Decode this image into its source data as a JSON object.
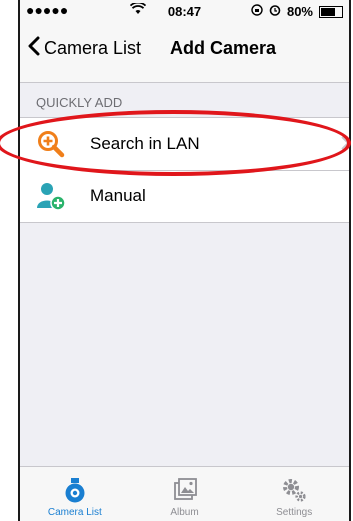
{
  "status_bar": {
    "signal": "●●●●●",
    "time": "08:47",
    "battery_percent": "80%",
    "battery_level": 0.8
  },
  "nav": {
    "back_label": "Camera List",
    "title": "Add Camera"
  },
  "section": {
    "header": "QUICKLY ADD"
  },
  "items": [
    {
      "label": "Search in LAN",
      "icon": "search-plus-icon"
    },
    {
      "label": "Manual",
      "icon": "add-user-icon"
    }
  ],
  "tabs": [
    {
      "label": "Camera List",
      "icon": "camera-icon",
      "active": true
    },
    {
      "label": "Album",
      "icon": "album-icon",
      "active": false
    },
    {
      "label": "Settings",
      "icon": "gear-icon",
      "active": false
    }
  ],
  "colors": {
    "accent": "#1a7fd1",
    "inactive": "#8e8e93",
    "highlight_ring": "#e0161b",
    "search_icon": "#f07f1a",
    "user_icon_teal": "#2aa3b5",
    "user_icon_green": "#2ab36b"
  }
}
